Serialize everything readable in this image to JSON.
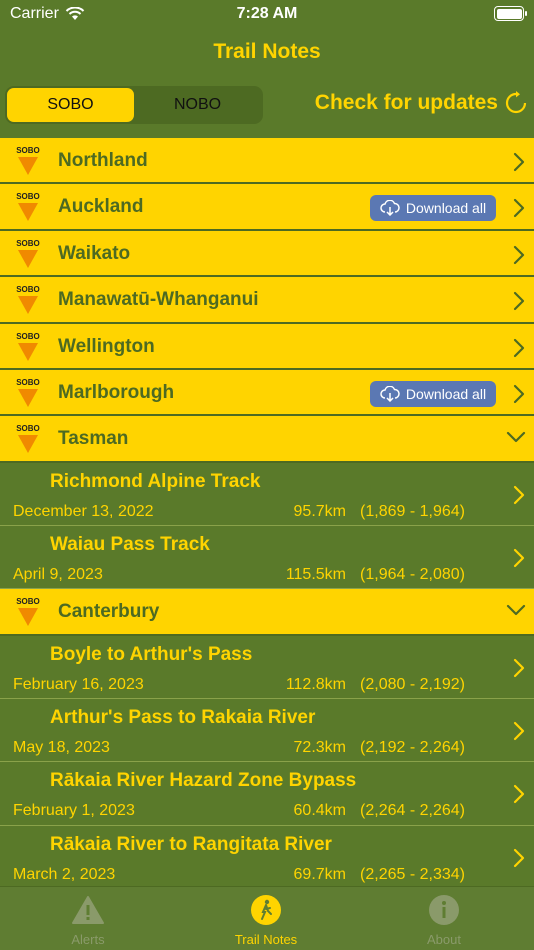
{
  "status_bar": {
    "carrier": "Carrier",
    "time": "7:28 AM"
  },
  "nav": {
    "title": "Trail Notes"
  },
  "segments": [
    {
      "label": "SOBO",
      "selected": true
    },
    {
      "label": "NOBO",
      "selected": false
    }
  ],
  "check_updates_label": "Check for updates",
  "badge_label": "SOBO",
  "download_all_label": "Download all",
  "regions": [
    {
      "name": "Northland",
      "download": false,
      "expanded": false
    },
    {
      "name": "Auckland",
      "download": true,
      "expanded": false
    },
    {
      "name": "Waikato",
      "download": false,
      "expanded": false
    },
    {
      "name": "Manawatū-Whanganui",
      "download": false,
      "expanded": false
    },
    {
      "name": "Wellington",
      "download": false,
      "expanded": false
    },
    {
      "name": "Marlborough",
      "download": true,
      "expanded": false
    },
    {
      "name": "Tasman",
      "download": false,
      "expanded": true
    },
    {
      "name": "Canterbury",
      "download": false,
      "expanded": true
    }
  ],
  "tracks": {
    "tasman": [
      {
        "title": "Richmond Alpine Track",
        "date": "December 13, 2022",
        "distance": "95.7km",
        "range": "(1,869 - 1,964)"
      },
      {
        "title": "Waiau Pass Track",
        "date": "April 9, 2023",
        "distance": "115.5km",
        "range": "(1,964 - 2,080)"
      }
    ],
    "canterbury": [
      {
        "title": "Boyle to Arthur's Pass",
        "date": "February 16, 2023",
        "distance": "112.8km",
        "range": "(2,080 - 2,192)"
      },
      {
        "title": "Arthur's Pass to Rakaia River",
        "date": "May 18, 2023",
        "distance": "72.3km",
        "range": "(2,192 - 2,264)"
      },
      {
        "title": "Rākaia River Hazard Zone Bypass",
        "date": "February 1, 2023",
        "distance": "60.4km",
        "range": "(2,264 - 2,264)"
      },
      {
        "title": "Rākaia River to Rangitata River",
        "date": "March 2, 2023",
        "distance": "69.7km",
        "range": "(2,265 - 2,334)"
      }
    ]
  },
  "tabs": [
    {
      "label": "Alerts",
      "icon": "warning-icon",
      "active": false
    },
    {
      "label": "Trail Notes",
      "icon": "hiker-icon",
      "active": true
    },
    {
      "label": "About",
      "icon": "info-icon",
      "active": false
    }
  ],
  "colors": {
    "accent": "#ffd400",
    "background": "#5a7a2a",
    "button": "#5b78b3"
  }
}
